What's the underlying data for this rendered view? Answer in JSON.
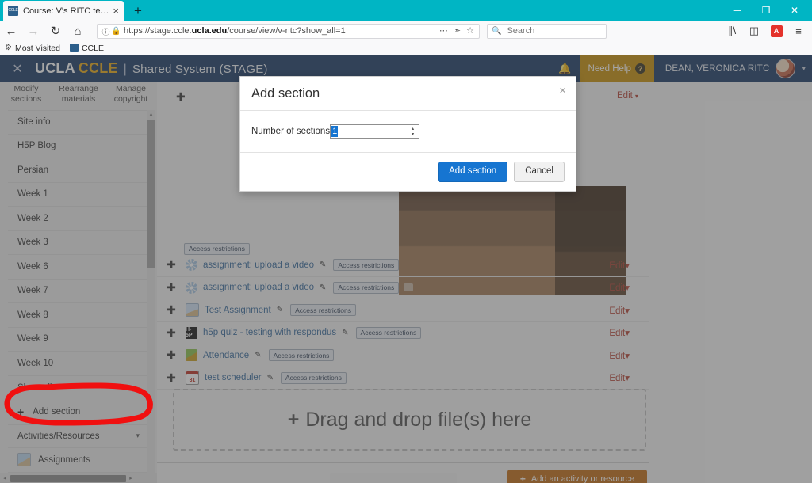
{
  "browser": {
    "tab": {
      "title": "Course: V's RITC testing site",
      "favicon": "ccle-favicon",
      "close": "×"
    },
    "new_tab": "+",
    "window_controls": {
      "minimize": "─",
      "maximize": "❐",
      "close": "✕"
    },
    "nav": {
      "back": "←",
      "forward": "→",
      "reload": "↻",
      "home": "⌂"
    },
    "url": {
      "info_icon": "ⓘ",
      "lock_icon": "🔒",
      "prefix": "https://stage.ccle.",
      "domain": "ucla.edu",
      "suffix": "/course/view/v-ritc?show_all=1",
      "full": "https://stage.ccle.ucla.edu/course/view/v-ritc?show_all=1",
      "actions": {
        "more": "⋯",
        "pocket": "▼",
        "bookmark": "☆"
      }
    },
    "search": {
      "placeholder": "Search",
      "value": "",
      "icon": "search-icon"
    },
    "toolbar_icons": {
      "library": "library-icon",
      "sidebar": "sidebar-icon",
      "pdf": "A",
      "menu": "≡"
    },
    "bookmarks": [
      {
        "label": "Most Visited",
        "icon": "gear-icon"
      },
      {
        "label": "CCLE",
        "icon": "ccle-favicon"
      }
    ]
  },
  "ccle_header": {
    "close": "✕",
    "brand_ucla": "UCLA",
    "brand_ccle": "CCLE",
    "separator": "|",
    "system": "Shared System (STAGE)",
    "bell_icon": "bell-icon",
    "need_help": "Need Help",
    "need_help_mark": "?",
    "user_name": "DEAN, VERONICA RITC",
    "caret": "▾"
  },
  "sidebar": {
    "tabs": [
      {
        "line1": "Modify",
        "line2": "sections"
      },
      {
        "line1": "Rearrange",
        "line2": "materials"
      },
      {
        "line1": "Manage",
        "line2": "copyright"
      }
    ],
    "items": [
      {
        "label": "Site info"
      },
      {
        "label": "H5P Blog"
      },
      {
        "label": "Persian"
      },
      {
        "label": "Week 1"
      },
      {
        "label": "Week 2"
      },
      {
        "label": "Week 3"
      },
      {
        "label": "Week 6"
      },
      {
        "label": "Week 7"
      },
      {
        "label": "Week 8"
      },
      {
        "label": "Week 9"
      },
      {
        "label": "Week 10"
      },
      {
        "label": "Show all"
      }
    ],
    "add_section": {
      "plus": "+",
      "label": "Add section"
    },
    "activities_group": {
      "label": "Activities/Resources",
      "caret": "▾"
    },
    "assignments": {
      "label": "Assignments",
      "icon": "assignment-icon"
    },
    "scroll_up": "▴",
    "scroll_down": "▾",
    "scroll_left": "◂",
    "scroll_right": "▸"
  },
  "content": {
    "section_move_icon": "move-handle-icon",
    "section_edit": {
      "label": "Edit",
      "caret": "▾"
    },
    "access_restrictions_badge": "Access restrictions",
    "activities": [
      {
        "icon": "star-icon",
        "icon_type": "star",
        "name": "assignment: upload a video",
        "pencil": "✎",
        "badge": "Access restrictions",
        "edit": "Edit",
        "caret": "▾"
      },
      {
        "icon": "star-icon",
        "icon_type": "star",
        "name": "assignment: upload a video",
        "pencil": "✎",
        "badge": "Access restrictions",
        "edit": "Edit",
        "caret": "▾"
      },
      {
        "icon": "document-icon",
        "icon_type": "doc",
        "name": "Test Assignment",
        "pencil": "✎",
        "badge": "Access restrictions",
        "edit": "Edit",
        "caret": "▾"
      },
      {
        "icon": "h5p-icon",
        "icon_type": "h5p",
        "icon_text": "H-5P",
        "name": "h5p quiz - testing with respondus",
        "pencil": "✎",
        "badge": "Access restrictions",
        "edit": "Edit",
        "caret": "▾"
      },
      {
        "icon": "attendance-icon",
        "icon_type": "green",
        "name": "Attendance",
        "pencil": "✎",
        "badge": "Access restrictions",
        "edit": "Edit",
        "caret": "▾"
      },
      {
        "icon": "calendar-icon",
        "icon_type": "cal",
        "icon_text": "31",
        "name": "test scheduler",
        "pencil": "✎",
        "badge": "Access restrictions",
        "edit": "Edit",
        "caret": "▾"
      }
    ],
    "dropzone": {
      "plus": "+",
      "label": "Drag and drop file(s) here"
    },
    "add_activity": {
      "plus": "+",
      "label": "Add an activity or resource"
    }
  },
  "modal": {
    "title": "Add section",
    "close": "×",
    "field_label": "Number of sections",
    "field_value": "1",
    "spin_up": "▴",
    "spin_down": "▾",
    "submit": "Add section",
    "cancel": "Cancel"
  },
  "annotation": {
    "shape": "red-ellipse",
    "color": "#f01010",
    "target": "Add section"
  },
  "colors": {
    "titlebar": "#00b5c4",
    "ccle_navy": "#22406a",
    "ccle_gold": "#e8ab1b",
    "need_help": "#c89211",
    "primary_blue": "#1675d1",
    "edit_red": "#b4483a",
    "orange_button": "#c1701c",
    "annotation_red": "#f01010"
  }
}
